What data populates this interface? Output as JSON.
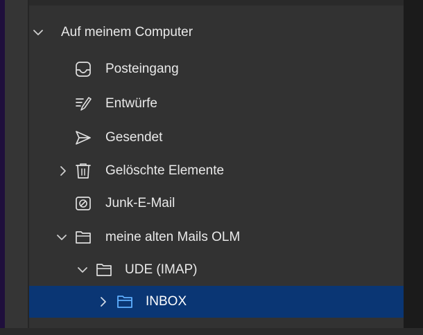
{
  "account": {
    "label": "Auf meinem Computer",
    "expanded": true
  },
  "folders": [
    {
      "label": "Posteingang",
      "icon": "inbox-icon"
    },
    {
      "label": "Entwürfe",
      "icon": "drafts-icon"
    },
    {
      "label": "Gesendet",
      "icon": "sent-icon"
    },
    {
      "label": "Gelöschte Elemente",
      "icon": "trash-icon",
      "expandable": true,
      "expanded": false
    },
    {
      "label": "Junk-E-Mail",
      "icon": "junk-icon"
    },
    {
      "label": "meine alten Mails OLM",
      "icon": "folder-icon",
      "expandable": true,
      "expanded": true
    },
    {
      "label": "UDE (IMAP)",
      "icon": "folder-icon",
      "expandable": true,
      "expanded": true
    },
    {
      "label": "INBOX",
      "icon": "folder-icon",
      "expandable": true,
      "expanded": false,
      "selected": true
    }
  ],
  "colors": {
    "selection": "#0a3674",
    "folder_selected": "#5fb0ff",
    "text": "#e9e9e9",
    "icon": "#e0e0e0"
  }
}
